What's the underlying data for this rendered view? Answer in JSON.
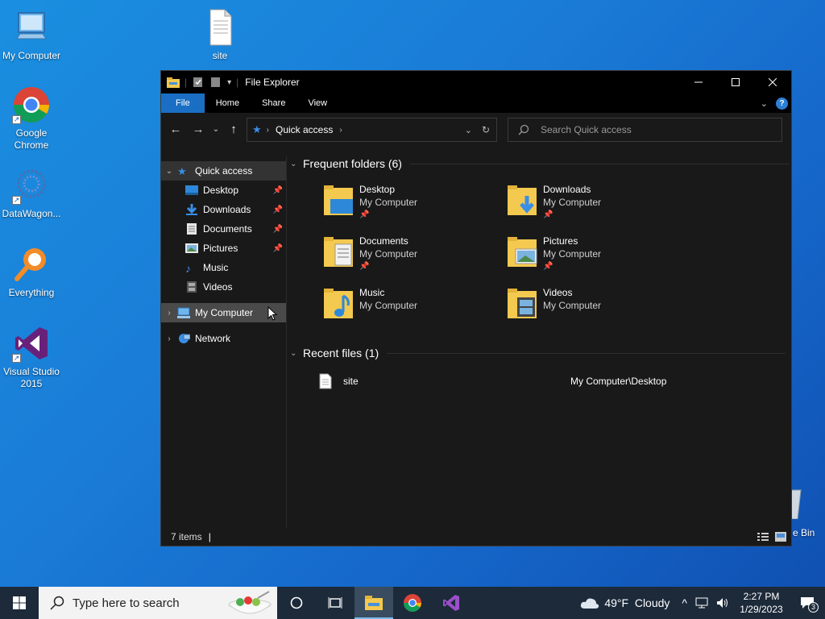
{
  "desktop": {
    "icons": [
      {
        "label": "My Computer"
      },
      {
        "label": "Google Chrome"
      },
      {
        "label": "DataWagon..."
      },
      {
        "label": "Everything"
      },
      {
        "label": "Visual Studio 2015"
      },
      {
        "label": "site"
      }
    ],
    "recycle_bin_label_partial": "e Bin"
  },
  "window": {
    "title": "File Explorer",
    "ribbon_tabs": [
      "File",
      "Home",
      "Share",
      "View"
    ],
    "address_path": "Quick access",
    "search_placeholder": "Search Quick access",
    "sidebar": [
      {
        "label": "Quick access"
      },
      {
        "label": "Desktop"
      },
      {
        "label": "Downloads"
      },
      {
        "label": "Documents"
      },
      {
        "label": "Pictures"
      },
      {
        "label": "Music"
      },
      {
        "label": "Videos"
      },
      {
        "label": "My Computer"
      },
      {
        "label": "Network"
      }
    ],
    "frequent_header": "Frequent folders (6)",
    "folders": [
      {
        "name": "Desktop",
        "location": "My Computer",
        "pinned": true
      },
      {
        "name": "Downloads",
        "location": "My Computer",
        "pinned": true
      },
      {
        "name": "Documents",
        "location": "My Computer",
        "pinned": true
      },
      {
        "name": "Pictures",
        "location": "My Computer",
        "pinned": true
      },
      {
        "name": "Music",
        "location": "My Computer",
        "pinned": false
      },
      {
        "name": "Videos",
        "location": "My Computer",
        "pinned": false
      }
    ],
    "recent_header": "Recent files (1)",
    "recent_files": [
      {
        "name": "site",
        "path": "My Computer\\Desktop"
      }
    ],
    "status": "7 items"
  },
  "taskbar": {
    "search_placeholder": "Type here to search",
    "weather": "49°F  Cloudy",
    "time": "2:27 PM",
    "date": "1/29/2023",
    "notification_count": "3"
  },
  "colors": {
    "accent": "#1a6fc4",
    "folder_yellow": "#f3c94f",
    "window_bg": "#191919"
  }
}
